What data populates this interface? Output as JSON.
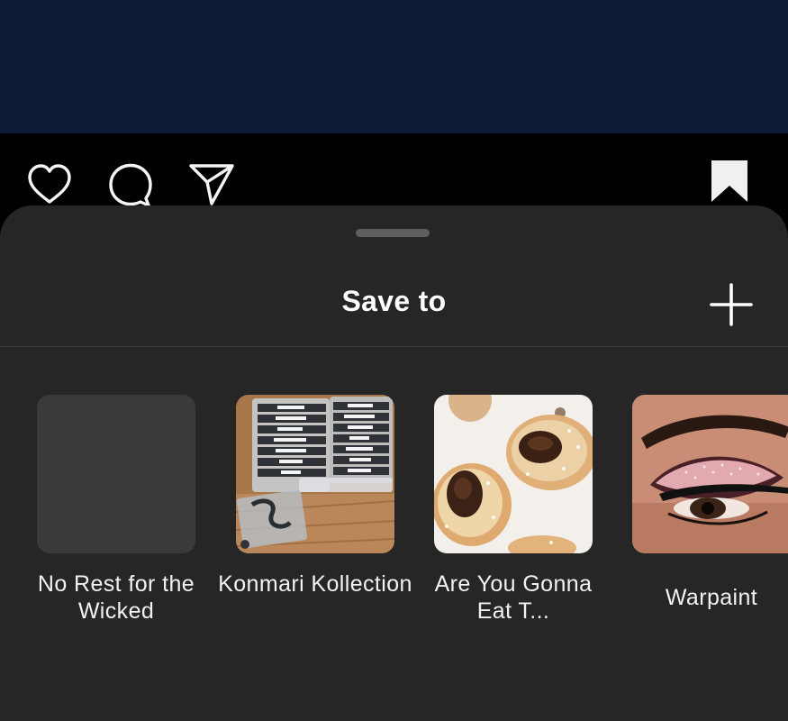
{
  "post": {
    "image_color": "#0f1a36"
  },
  "actions": {
    "like_icon": "heart-outline-icon",
    "comment_icon": "speech-bubble-icon",
    "share_icon": "paper-plane-icon",
    "save_icon": "bookmark-filled-icon"
  },
  "sheet": {
    "title": "Save to",
    "add_icon": "plus-icon",
    "background": "#262626"
  },
  "collections": [
    {
      "label": "No Rest for the Wicked",
      "thumbnail": "empty-placeholder"
    },
    {
      "label": "Konmari Kollection",
      "thumbnail": "storage-boxes-photo"
    },
    {
      "label": "Are You Gonna Eat T...",
      "thumbnail": "chocolate-pastry-photo"
    },
    {
      "label": "Warpaint",
      "thumbnail": "eye-makeup-photo"
    }
  ]
}
